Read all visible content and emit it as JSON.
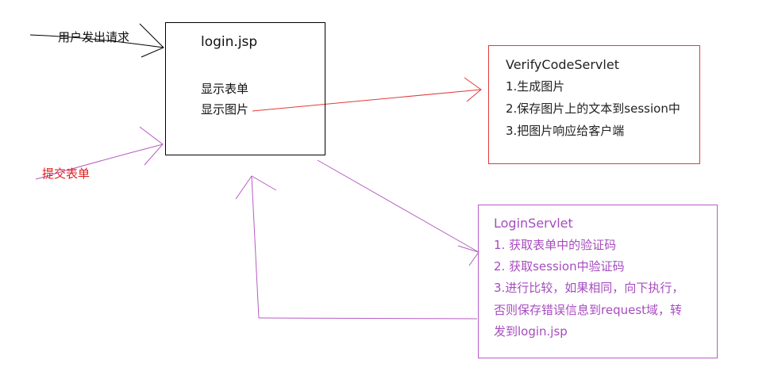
{
  "colors": {
    "black": "#000000",
    "red": "#e23a3a",
    "purple": "#b65cc4"
  },
  "user_request": "用户发出请求",
  "submit_form": "提交表单",
  "login_jsp": {
    "title": "login.jsp",
    "items": [
      "显示表单",
      "显示图片"
    ]
  },
  "verify_servlet": {
    "title": "VerifyCodeServlet",
    "items": [
      "1.生成图片",
      "2.保存图片上的文本到session中",
      "3.把图片响应给客户端"
    ]
  },
  "login_servlet": {
    "title": "LoginServlet",
    "items": [
      "1. 获取表单中的验证码",
      "2. 获取session中验证码",
      "3.进行比较，如果相同，向下执行，",
      "否则保存错误信息到request域，转",
      "发到login.jsp"
    ]
  }
}
